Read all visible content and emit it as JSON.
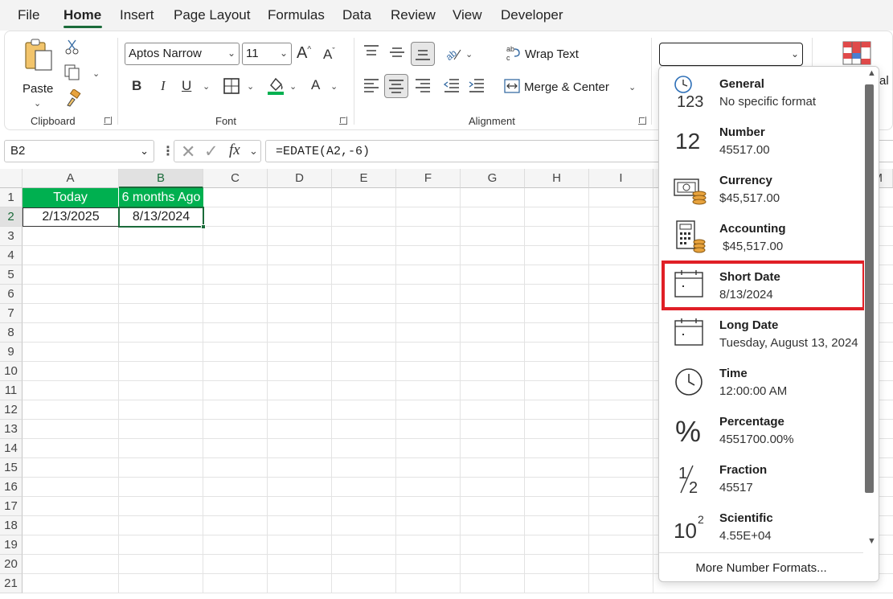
{
  "menu": {
    "items": [
      "File",
      "Home",
      "Insert",
      "Page Layout",
      "Formulas",
      "Data",
      "Review",
      "View",
      "Developer"
    ],
    "active": "Home"
  },
  "ribbon": {
    "clipboard": {
      "paste_label": "Paste",
      "group_label": "Clipboard"
    },
    "font": {
      "font_name": "Aptos Narrow",
      "font_size": "11",
      "group_label": "Font",
      "bold": "B",
      "italic": "I",
      "underline": "U"
    },
    "alignment": {
      "wrap_text": "Wrap Text",
      "merge_center": "Merge & Center",
      "group_label": "Alignment"
    },
    "number_format_value": "",
    "partial_label": "al"
  },
  "formula_bar": {
    "name_box": "B2",
    "formula": "=EDATE(A2,-6)",
    "fx_label": "fx"
  },
  "grid": {
    "columns": [
      "A",
      "B",
      "C",
      "D",
      "E",
      "F",
      "G",
      "H",
      "I"
    ],
    "partial_column": "M",
    "rows": [
      "1",
      "2",
      "3",
      "4",
      "5",
      "6",
      "7",
      "8",
      "9",
      "10",
      "11",
      "12",
      "13",
      "14",
      "15",
      "16",
      "17",
      "18",
      "19",
      "20",
      "21"
    ],
    "selected_cell": "B2",
    "header_fill": "#00b050",
    "cells": {
      "A1": "Today",
      "B1": "6 months Ago",
      "A2": "2/13/2025",
      "B2": "8/13/2024"
    }
  },
  "number_format_menu": {
    "options": [
      {
        "title": "General",
        "sample": "No specific format",
        "icon": "clock-123-icon"
      },
      {
        "title": "Number",
        "sample": "45517.00",
        "icon": "number-12-icon"
      },
      {
        "title": "Currency",
        "sample": "$45,517.00",
        "icon": "currency-icon"
      },
      {
        "title": "Accounting",
        "sample": " $45,517.00",
        "icon": "accounting-icon"
      },
      {
        "title": "Short Date",
        "sample": "8/13/2024",
        "icon": "calendar-icon"
      },
      {
        "title": "Long Date",
        "sample": "Tuesday, August 13, 2024",
        "icon": "calendar-icon"
      },
      {
        "title": "Time",
        "sample": "12:00:00 AM",
        "icon": "clock-icon"
      },
      {
        "title": "Percentage",
        "sample": "4551700.00%",
        "icon": "percent-icon"
      },
      {
        "title": "Fraction",
        "sample": "45517",
        "icon": "fraction-icon"
      },
      {
        "title": "Scientific",
        "sample": "4.55E+04",
        "icon": "scientific-icon"
      }
    ],
    "highlighted": "Short Date",
    "highlight_color": "#e01f26",
    "more_formats": "More Number Formats..."
  }
}
